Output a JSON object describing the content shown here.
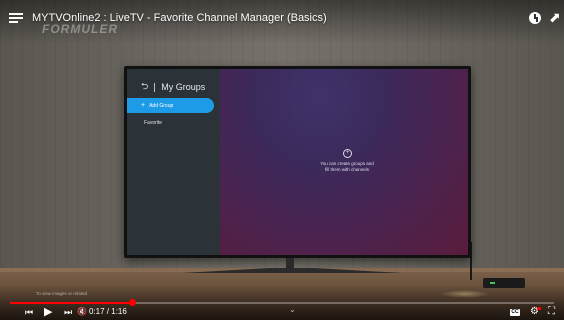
{
  "player": {
    "video_title": "MYTVOnline2 : LiveTV - Favorite Channel Manager (Basics)",
    "watermark": "FORMULER",
    "time_current": "0:17",
    "time_separator": " / ",
    "time_total": "1:16",
    "progress_fraction": 0.2237,
    "preview_caption": "To view images or related",
    "colors": {
      "progress": "#ff0000",
      "text": "#ffffff"
    },
    "icons": [
      "menu-icon",
      "clock-icon",
      "share-icon",
      "skip-previous-icon",
      "play-icon",
      "skip-next-icon",
      "mute-icon",
      "cc-icon",
      "settings-icon",
      "fullscreen-icon"
    ]
  },
  "tv_app": {
    "sidebar_title": "My Groups",
    "back_icon": "back-arrow-icon",
    "add_group_label": "Add Group",
    "groups": [
      "Favorite"
    ],
    "empty_line1": "You can create groups and",
    "empty_line2": "fill them with channels",
    "colors": {
      "accent": "#1e9be6",
      "sidebar": "#2b3238"
    }
  }
}
